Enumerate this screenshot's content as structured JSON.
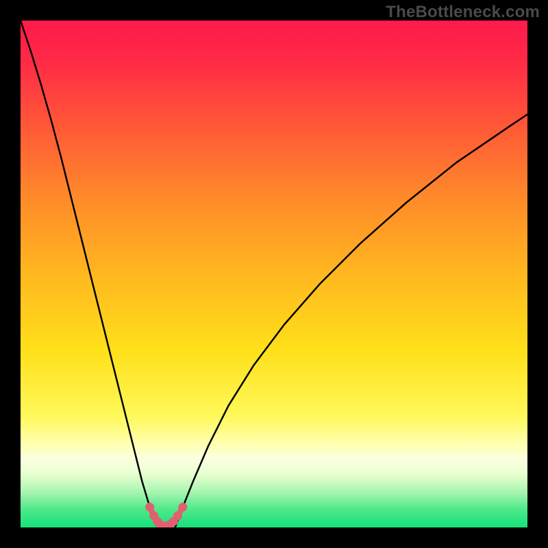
{
  "watermark": "TheBottleneck.com",
  "chart_data": {
    "type": "line",
    "title": "",
    "xlabel": "",
    "ylabel": "",
    "xlim": [
      0,
      100
    ],
    "ylim": [
      0,
      100
    ],
    "grid": false,
    "legend": false,
    "background_gradient": {
      "stops": [
        {
          "offset": 0.0,
          "color": "#ff1a4b"
        },
        {
          "offset": 0.08,
          "color": "#ff2a46"
        },
        {
          "offset": 0.2,
          "color": "#ff5538"
        },
        {
          "offset": 0.35,
          "color": "#ff8a2a"
        },
        {
          "offset": 0.5,
          "color": "#ffb71f"
        },
        {
          "offset": 0.65,
          "color": "#ffe01a"
        },
        {
          "offset": 0.78,
          "color": "#fff85a"
        },
        {
          "offset": 0.835,
          "color": "#ffffb0"
        },
        {
          "offset": 0.865,
          "color": "#fbffe0"
        },
        {
          "offset": 0.895,
          "color": "#e8ffd0"
        },
        {
          "offset": 0.93,
          "color": "#a8f5b0"
        },
        {
          "offset": 0.965,
          "color": "#4de889"
        },
        {
          "offset": 1.0,
          "color": "#14e27a"
        }
      ]
    },
    "series": [
      {
        "name": "left-branch",
        "color": "#000000",
        "x": [
          0.0,
          2.0,
          4.0,
          6.0,
          8.0,
          10.0,
          12.0,
          14.0,
          16.0,
          18.0,
          20.0,
          22.0,
          24.0,
          25.5,
          27.0
        ],
        "y": [
          100.0,
          94.0,
          87.5,
          80.5,
          73.0,
          65.0,
          57.0,
          49.0,
          41.0,
          33.0,
          25.0,
          17.0,
          9.0,
          4.0,
          0.0
        ]
      },
      {
        "name": "right-branch",
        "color": "#000000",
        "x": [
          30.5,
          32.0,
          34.0,
          37.0,
          41.0,
          46.0,
          52.0,
          59.0,
          67.0,
          76.0,
          86.0,
          97.0,
          100.0
        ],
        "y": [
          0.0,
          4.0,
          9.0,
          16.0,
          24.0,
          32.0,
          40.0,
          48.0,
          56.0,
          64.0,
          72.0,
          79.5,
          81.5
        ]
      },
      {
        "name": "valley-marker",
        "color": "#e06070",
        "style": "dots+line",
        "x": [
          25.5,
          26.3,
          27.0,
          27.5,
          28.0,
          28.8,
          29.5,
          30.2,
          31.0,
          32.0
        ],
        "y": [
          4.0,
          2.3,
          1.2,
          0.6,
          0.3,
          0.3,
          0.6,
          1.2,
          2.3,
          4.0
        ]
      }
    ],
    "annotations": []
  }
}
